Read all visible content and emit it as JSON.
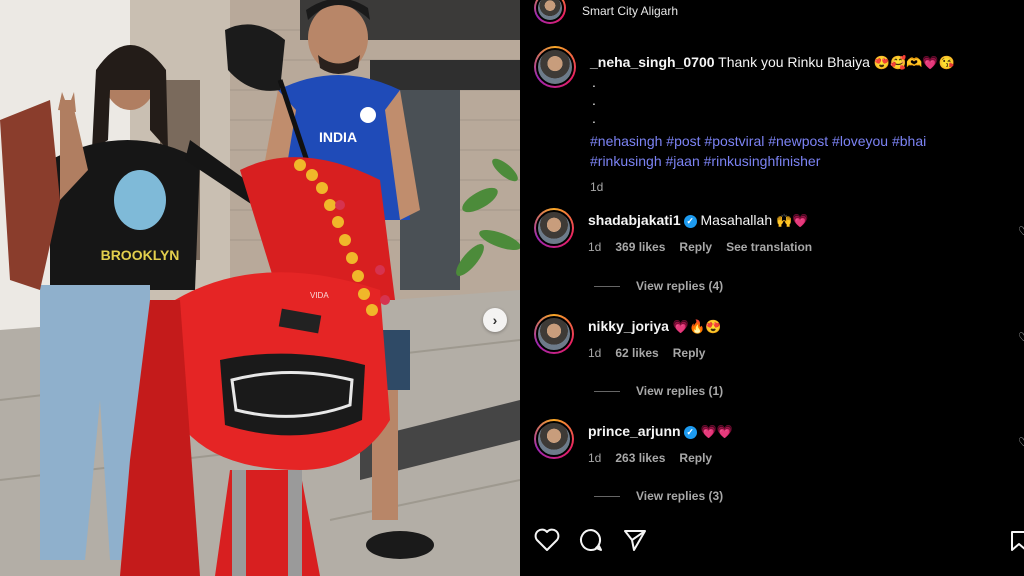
{
  "post": {
    "location": "Smart City Aligarh",
    "caption": {
      "username": "_neha_singh_0700",
      "text": "Thank you Rinku Bhaiya",
      "emojis": "😍🥰🫶💗😘",
      "dots": [
        ".",
        ".",
        "."
      ],
      "hashtags": "#nehasingh #post #postviral #newpost #loveyou #bhai #rinkusingh #jaan #rinkusinghfinisher",
      "age": "1d"
    },
    "comments": [
      {
        "username": "shadabjakati1",
        "verified": true,
        "text": "Masahallah",
        "emojis": "🙌💗",
        "age": "1d",
        "likes": "369 likes",
        "reply": "Reply",
        "translate": "See translation",
        "view_replies": "View replies (4)"
      },
      {
        "username": "nikky_joriya",
        "verified": false,
        "text": "",
        "emojis": "💗🔥😍",
        "age": "1d",
        "likes": "62 likes",
        "reply": "Reply",
        "view_replies": "View replies (1)"
      },
      {
        "username": "prince_arjunn",
        "verified": true,
        "text": "",
        "emojis": "💗💗",
        "age": "1d",
        "likes": "263 likes",
        "reply": "Reply",
        "view_replies": "View replies (3)"
      }
    ],
    "photo": {
      "jersey_text": "INDIA",
      "shirt_text": "BROOKLYN",
      "scooter_brand": "VIDA"
    },
    "icons": [
      "heart-icon",
      "comment-icon",
      "share-icon",
      "bookmark-icon",
      "next-arrow-icon"
    ]
  }
}
